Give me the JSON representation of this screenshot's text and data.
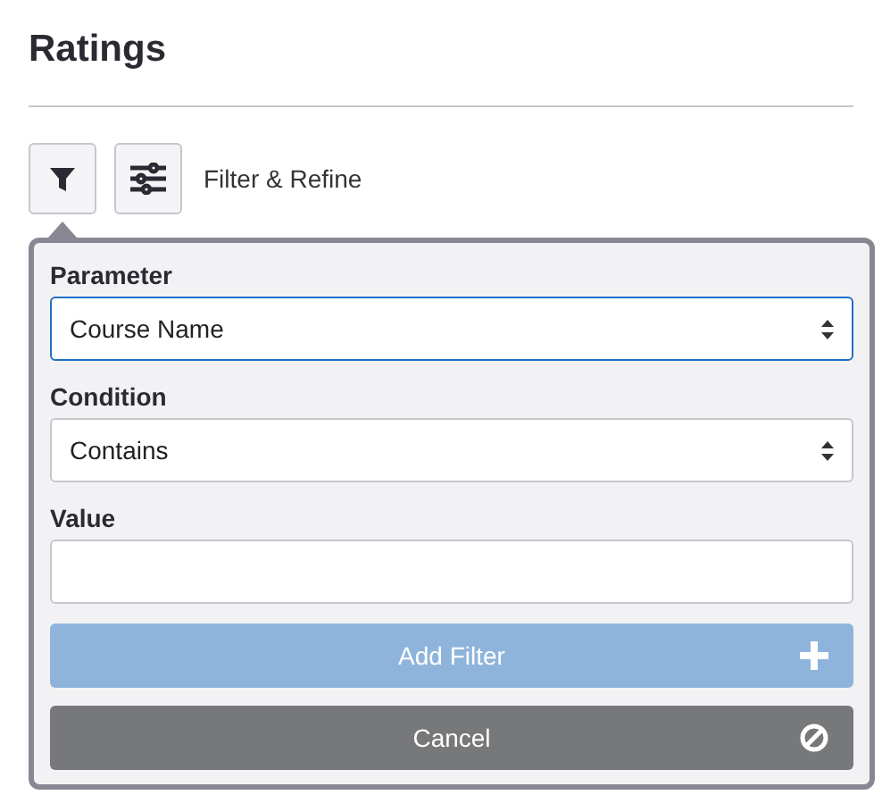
{
  "title": "Ratings",
  "toolbar": {
    "buttons": [
      {
        "kind": "filter"
      },
      {
        "kind": "sliders"
      }
    ],
    "label": "Filter & Refine"
  },
  "popover": {
    "fields": [
      {
        "label": "Parameter",
        "kind": "select",
        "value": "Course Name",
        "focused": true
      },
      {
        "label": "Condition",
        "kind": "select",
        "value": "Contains",
        "focused": false
      },
      {
        "label": "Value",
        "kind": "text",
        "focused": false
      }
    ],
    "buttons": [
      {
        "label": "Add Filter",
        "kind": "add",
        "disabled": true
      },
      {
        "label": "Cancel",
        "kind": "cancel",
        "disabled": false
      }
    ]
  }
}
